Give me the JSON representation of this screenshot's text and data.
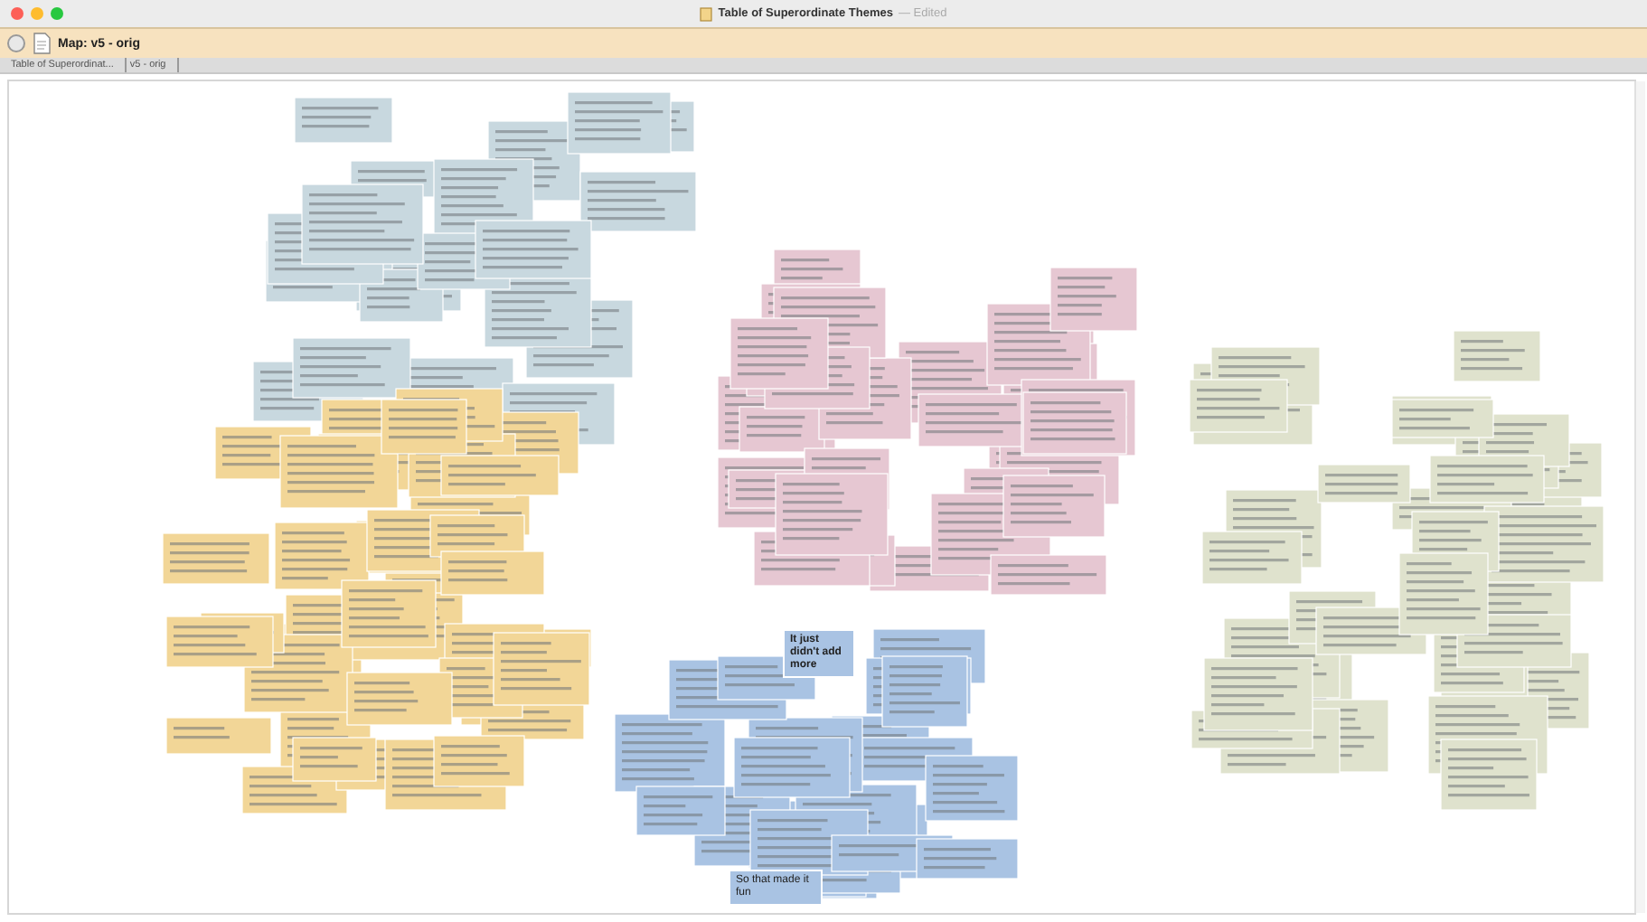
{
  "window": {
    "title": "Table of Superordinate Themes",
    "status": "— Edited"
  },
  "tab": {
    "label": "Map: v5 - orig"
  },
  "breadcrumbs": [
    {
      "label": "Table of Superordinat..."
    },
    {
      "label": "v5 - orig"
    }
  ],
  "clusters": [
    {
      "color": "#c8d8df"
    },
    {
      "color": "#f2d697"
    },
    {
      "color": "#e6c7d2"
    },
    {
      "color": "#dfe2cd"
    },
    {
      "color": "#a9c3e3"
    }
  ],
  "notes": [
    {
      "text": "It just didn't add more",
      "bold": true,
      "color": "#a9c3e3"
    },
    {
      "text": "So that made it fun",
      "bold": false,
      "color": "#a9c3e3"
    }
  ]
}
